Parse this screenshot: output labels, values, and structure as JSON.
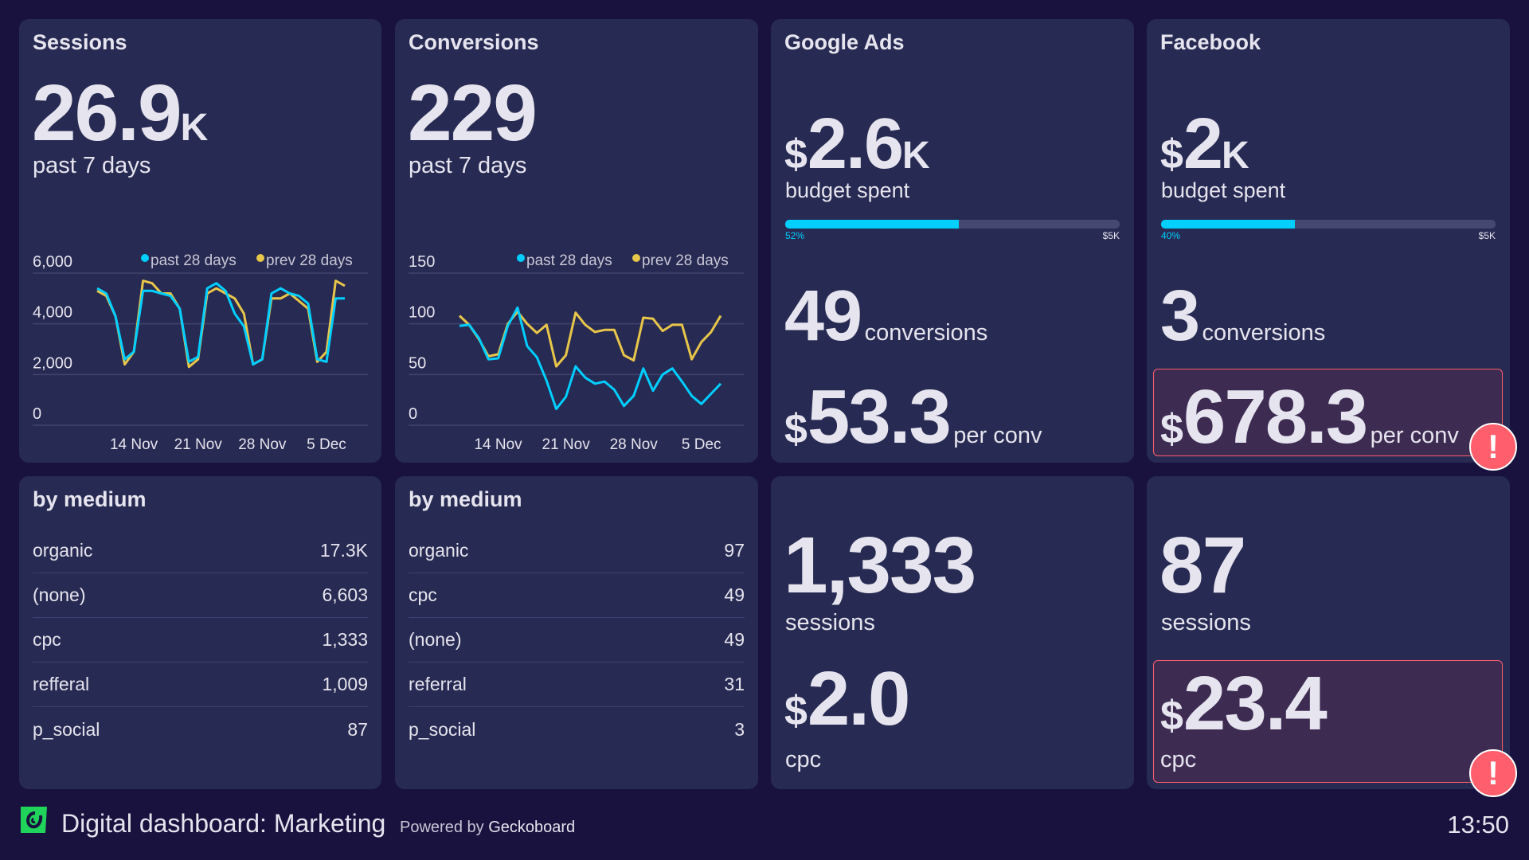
{
  "colors": {
    "background": "#19123e",
    "panel": "#272a52",
    "past": "#00cfff",
    "prev": "#e8c64a",
    "alert": "#ff5f6d"
  },
  "sessions": {
    "title": "Sessions",
    "value": "26.9",
    "unit": "K",
    "subtitle": "past 7 days"
  },
  "conversions": {
    "title": "Conversions",
    "value": "229",
    "subtitle": "past 7 days"
  },
  "google": {
    "title": "Google Ads",
    "currency": "$",
    "budget_value": "2.6",
    "budget_unit": "K",
    "budget_label": "budget spent",
    "progress_percent": 52,
    "progress_label": "52%",
    "progress_target": "$5K",
    "conversions": "49",
    "conversions_label": "conversions",
    "per_conv_value": "53.3",
    "per_conv_label": "per conv",
    "sessions": "1,333",
    "sessions_label": "sessions",
    "cpc_value": "2.0",
    "cpc_label": "cpc"
  },
  "facebook": {
    "title": "Facebook",
    "currency": "$",
    "budget_value": "2",
    "budget_unit": "K",
    "budget_label": "budget spent",
    "progress_percent": 40,
    "progress_label": "40%",
    "progress_target": "$5K",
    "conversions": "3",
    "conversions_label": "conversions",
    "per_conv_value": "678.3",
    "per_conv_label": "per conv",
    "per_conv_alert": true,
    "sessions": "87",
    "sessions_label": "sessions",
    "cpc_value": "23.4",
    "cpc_label": "cpc",
    "cpc_alert": true,
    "alert_icon": "exclamation-icon"
  },
  "sessions_medium": {
    "title": "by medium",
    "rows": [
      {
        "label": "organic",
        "value": "17.3K"
      },
      {
        "label": "(none)",
        "value": "6,603"
      },
      {
        "label": "cpc",
        "value": "1,333"
      },
      {
        "label": "refferal",
        "value": "1,009"
      },
      {
        "label": "p_social",
        "value": "87"
      }
    ]
  },
  "conversions_medium": {
    "title": "by medium",
    "rows": [
      {
        "label": "organic",
        "value": "97"
      },
      {
        "label": "cpc",
        "value": "49"
      },
      {
        "label": "(none)",
        "value": "49"
      },
      {
        "label": "referral",
        "value": "31"
      },
      {
        "label": "p_social",
        "value": "3"
      }
    ]
  },
  "footer": {
    "title": "Digital dashboard: Marketing",
    "powered_prefix": "Powered by",
    "powered_brand": "Geckoboard",
    "time": "13:50",
    "logo_icon": "geckoboard-logo-icon"
  },
  "chart_data": [
    {
      "type": "line",
      "grid": true,
      "legend": "top-right",
      "ylim": [
        0,
        6000
      ],
      "yticks": [
        "6,000",
        "4,000",
        "2,000",
        "0"
      ],
      "ytick_values": [
        6000,
        4000,
        2000,
        0
      ],
      "xticks": [
        "14 Nov",
        "21 Nov",
        "28 Nov",
        "5 Dec"
      ],
      "xtick_index": [
        4,
        11,
        18,
        25
      ],
      "series": [
        {
          "name": "past 28 days",
          "color": "#00cfff",
          "values": [
            5400,
            5200,
            4300,
            2600,
            2900,
            5300,
            5300,
            5200,
            5100,
            4600,
            2500,
            2700,
            5400,
            5600,
            5300,
            4400,
            3900,
            2400,
            2600,
            5200,
            5400,
            5200,
            5100,
            4800,
            2600,
            2500,
            5000,
            5000
          ]
        },
        {
          "name": "prev 28 days",
          "color": "#e8c64a",
          "values": [
            5300,
            5100,
            4300,
            2400,
            2900,
            5700,
            5600,
            5200,
            5200,
            4600,
            2300,
            2600,
            5200,
            5400,
            5200,
            5000,
            4400,
            2400,
            2600,
            5000,
            5000,
            5200,
            4900,
            4600,
            2500,
            2900,
            5700,
            5500
          ]
        }
      ]
    },
    {
      "type": "line",
      "grid": true,
      "legend": "top-right",
      "ylim": [
        0,
        150
      ],
      "yticks": [
        "150",
        "100",
        "50",
        "0"
      ],
      "ytick_values": [
        150,
        100,
        50,
        0
      ],
      "xticks": [
        "14 Nov",
        "21 Nov",
        "28 Nov",
        "5 Dec"
      ],
      "xtick_index": [
        4,
        11,
        18,
        25
      ],
      "series": [
        {
          "name": "past 28 days",
          "color": "#00cfff",
          "values": [
            98,
            99,
            86,
            65,
            66,
            98,
            116,
            78,
            67,
            44,
            16,
            28,
            58,
            47,
            41,
            43,
            35,
            19,
            29,
            56,
            34,
            50,
            56,
            43,
            29,
            21,
            31,
            41
          ]
        },
        {
          "name": "prev 28 days",
          "color": "#e8c64a",
          "values": [
            108,
            99,
            85,
            68,
            70,
            100,
            112,
            100,
            91,
            99,
            58,
            69,
            111,
            99,
            92,
            94,
            94,
            69,
            64,
            106,
            105,
            93,
            99,
            99,
            65,
            82,
            92,
            108
          ]
        }
      ]
    }
  ]
}
